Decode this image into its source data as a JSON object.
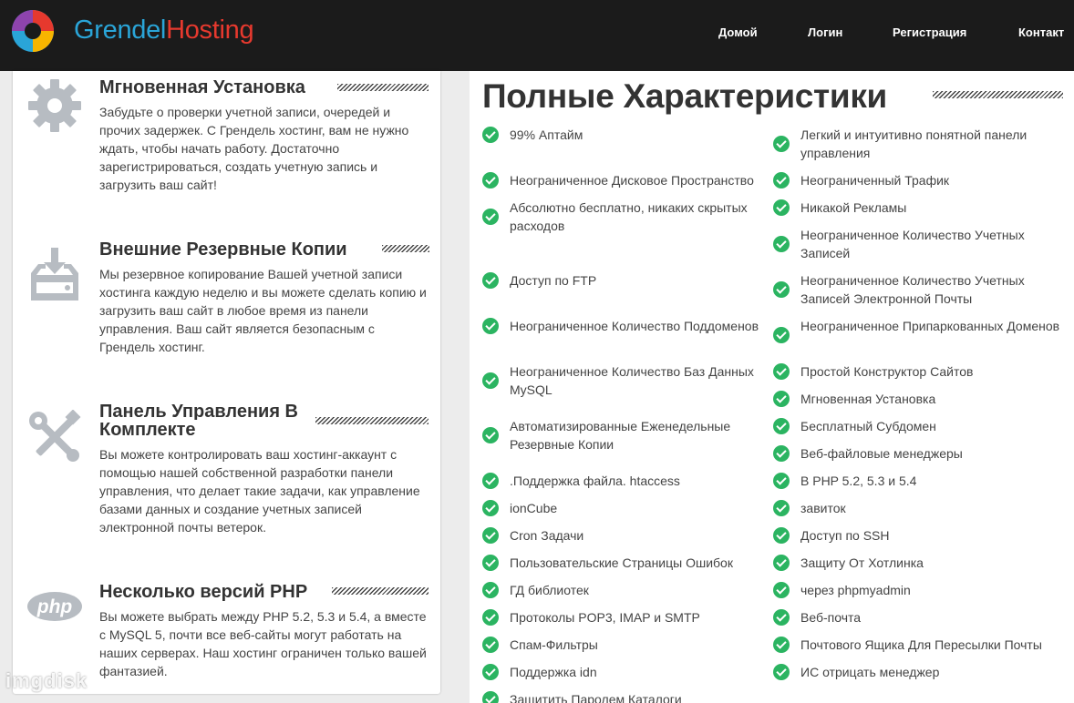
{
  "brand": {
    "part1": "Grendel",
    "part2": "Hosting"
  },
  "nav": [
    {
      "label": "Домой"
    },
    {
      "label": "Логин"
    },
    {
      "label": "Регистрация"
    },
    {
      "label": "Контакт"
    }
  ],
  "features": [
    {
      "icon": "gear-icon",
      "title": "Мгновенная Установка",
      "desc": "Забудьте о проверки учетной записи, очередей и прочих задержек. С Грендель хостинг, вам не нужно ждать, чтобы начать работу. Достаточно зарегистрироваться, создать учетную запись и загрузить ваш сайт!"
    },
    {
      "icon": "backup-download-icon",
      "title": "Внешние Резервные Копии",
      "desc": "Мы резервное копирование Вашей учетной записи хостинга каждую неделю и вы можете сделать копию и загрузить ваш сайт в любое время из панели управления. Ваш сайт является безопасным с Грендель хостинг."
    },
    {
      "icon": "tools-icon",
      "title": "Панель Управления В Комплекте",
      "desc": "Вы можете контролировать ваш хостинг-аккаунт с помощью нашей собственной разработки панели управления, что делает такие задачи, как управление базами данных и создание учетных записей электронной почты ветерок."
    },
    {
      "icon": "php-icon",
      "title": "Несколько версий PHP",
      "desc": "Вы можете выбрать между PHP 5.2, 5.3 и 5.4, а вместе с MySQL 5, почти все веб-сайты могут работать на наших серверах. Наш хостинг ограничен только вашей фантазией."
    }
  ],
  "php_icon_text": "php",
  "specs": {
    "title": "Полные Характеристики",
    "left": [
      "99% Аптайм",
      "Неограниченное Дисковое Пространство",
      "Абсолютно бесплатно, никаких скрытых расходов",
      "Доступ по FTP",
      "Неограниченное Количество Поддоменов",
      "Неограниченное Количество Баз Данных MySQL",
      "Автоматизированные Еженедельные Резервные Копии",
      ".Поддержка файла. htaccess",
      "ionCube",
      "Cron Задачи",
      "Пользовательские Страницы Ошибок",
      "ГД библиотек",
      "Протоколы POP3, IMAP и SMTP",
      "Спам-Фильтры",
      "Поддержка idn",
      "Защитить Паролем Каталоги"
    ],
    "right": [
      "Легкий и интуитивно понятной панели управления",
      "Неограниченный Трафик",
      "Никакой Рекламы",
      "Неограниченное Количество Учетных Записей",
      "Неограниченное Количество Учетных Записей Электронной Почты",
      "Неограниченное Припаркованных Доменов",
      "Простой Конструктор Сайтов",
      "Мгновенная Установка",
      "Бесплатный Субдомен",
      "Веб-файловые менеджеры",
      "В PHP 5.2, 5.3 и 5.4",
      "завиток",
      "Доступ по SSH",
      "Защиту От Хотлинка",
      "через phpmyadmin",
      "Веб-почта",
      "Почтового Ящика Для Пересылки Почты",
      "ИС отрицать менеджер"
    ]
  },
  "watermark": "imgdisk",
  "colors": {
    "header": "#1b1b1b",
    "brand_blue": "#2aa5d8",
    "brand_red": "#e6392e",
    "check_green": "#2bb461",
    "icon_gray": "#b7bcc2"
  }
}
